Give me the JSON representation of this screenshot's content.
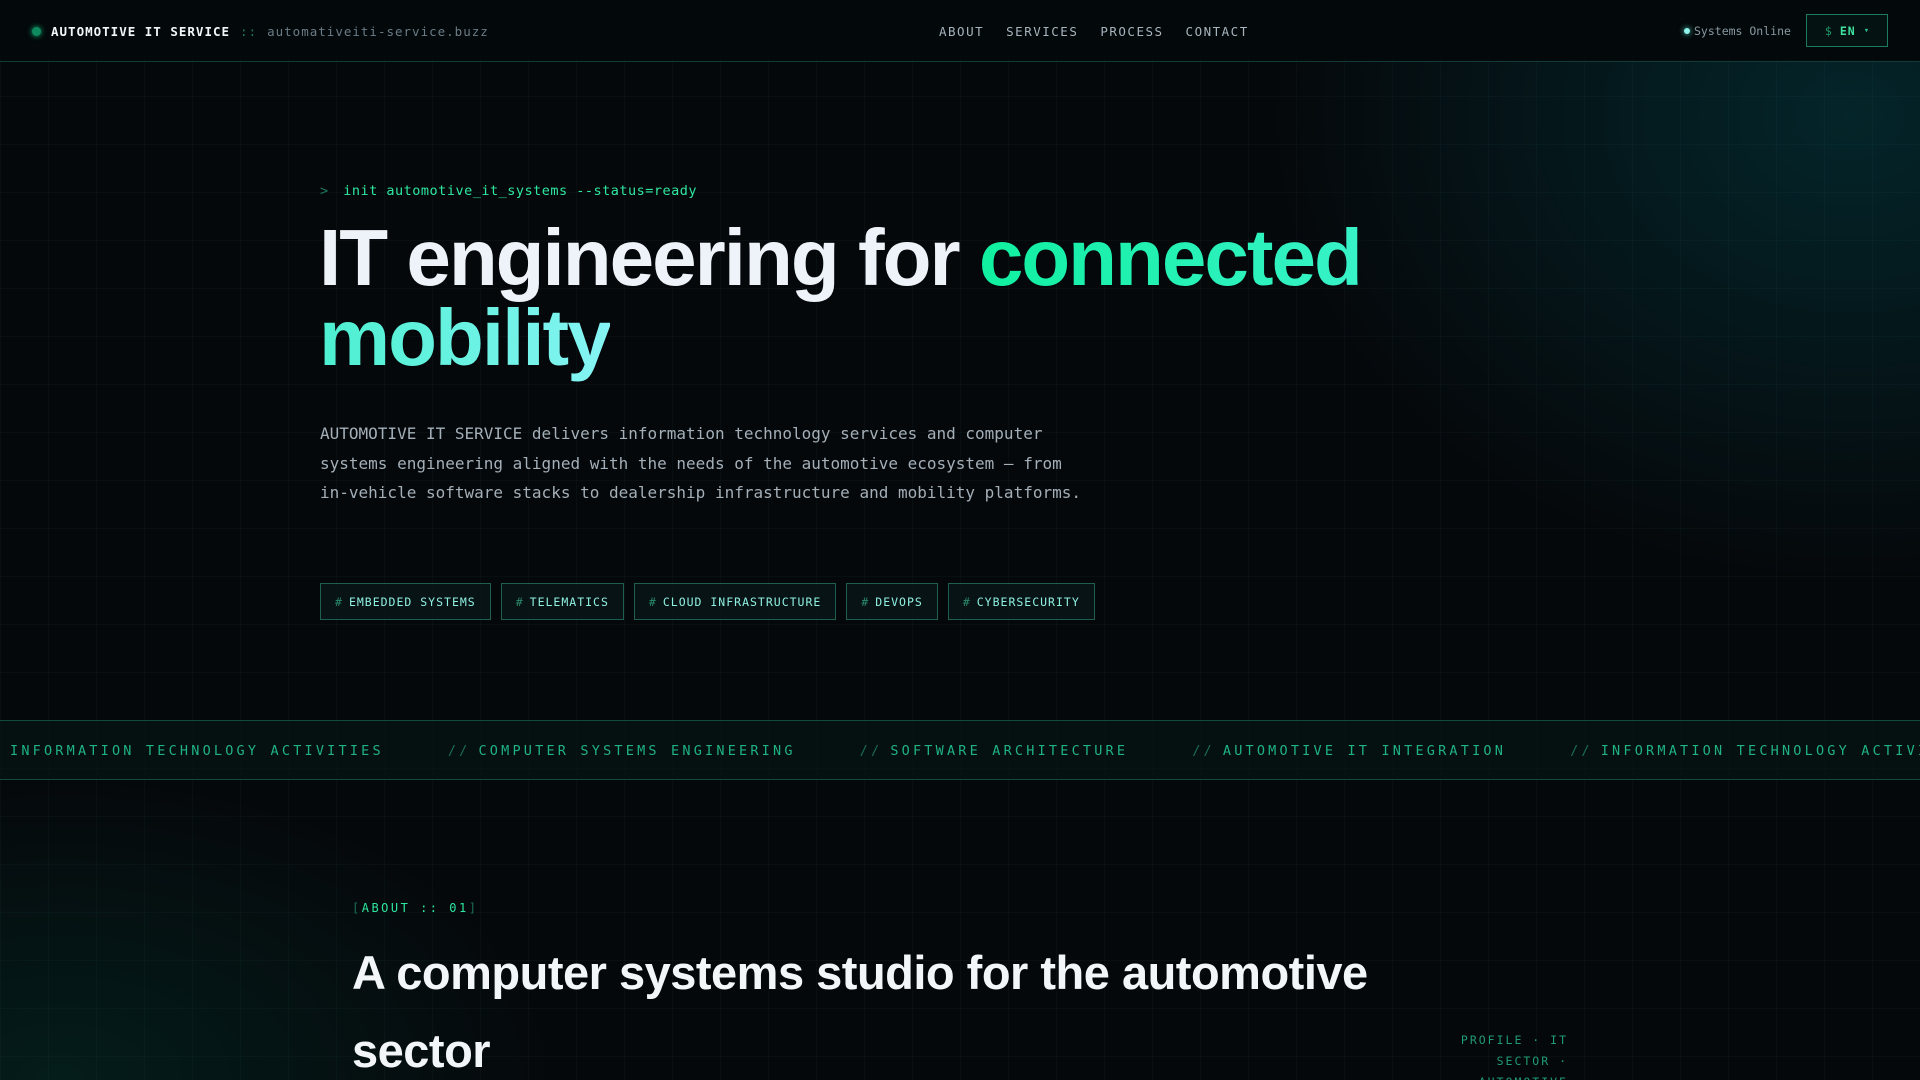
{
  "nav": {
    "brand_name": "AUTOMOTIVE IT SERVICE",
    "brand_separator": "::",
    "brand_domain": "automativeiti-service.buzz",
    "links": [
      "ABOUT",
      "SERVICES",
      "PROCESS",
      "CONTACT"
    ],
    "status_text": "Systems Online",
    "lang_prompt": "$",
    "lang_code": "EN",
    "lang_caret": "▾"
  },
  "hero": {
    "command_prompt": ">",
    "command": "init automotive_it_systems --status=ready",
    "headline_part1": "IT engineering for ",
    "headline_part2": "connected",
    "headline_part3": "mobility",
    "description": "AUTOMOTIVE IT SERVICE delivers information technology services and computer systems engineering aligned with the needs of the automotive ecosystem — from in-vehicle software stacks to dealership infrastructure and mobility platforms.",
    "tag_prefix": "#",
    "tags": [
      "EMBEDDED SYSTEMS",
      "TELEMATICS",
      "CLOUD INFRASTRUCTURE",
      "DEVOPS",
      "CYBERSECURITY"
    ]
  },
  "ticker": {
    "separator": "//",
    "items": [
      "INFORMATION TECHNOLOGY ACTIVITIES",
      "COMPUTER SYSTEMS ENGINEERING",
      "SOFTWARE ARCHITECTURE",
      "AUTOMOTIVE IT INTEGRATION",
      "INFORMATION TECHNOLOGY ACTIVITIES"
    ]
  },
  "about": {
    "bracket_open": "[",
    "tag": "ABOUT :: 01",
    "bracket_close": "]",
    "title": "A computer systems studio for the automotive sector",
    "profile_text": "PROFILE · IT SECTOR · AUTOMOTIVE"
  },
  "colors": {
    "background": "#05080b",
    "accent_green": "#10f0a0",
    "accent_cyan": "#86f4f4",
    "border": "#1f5f52"
  }
}
